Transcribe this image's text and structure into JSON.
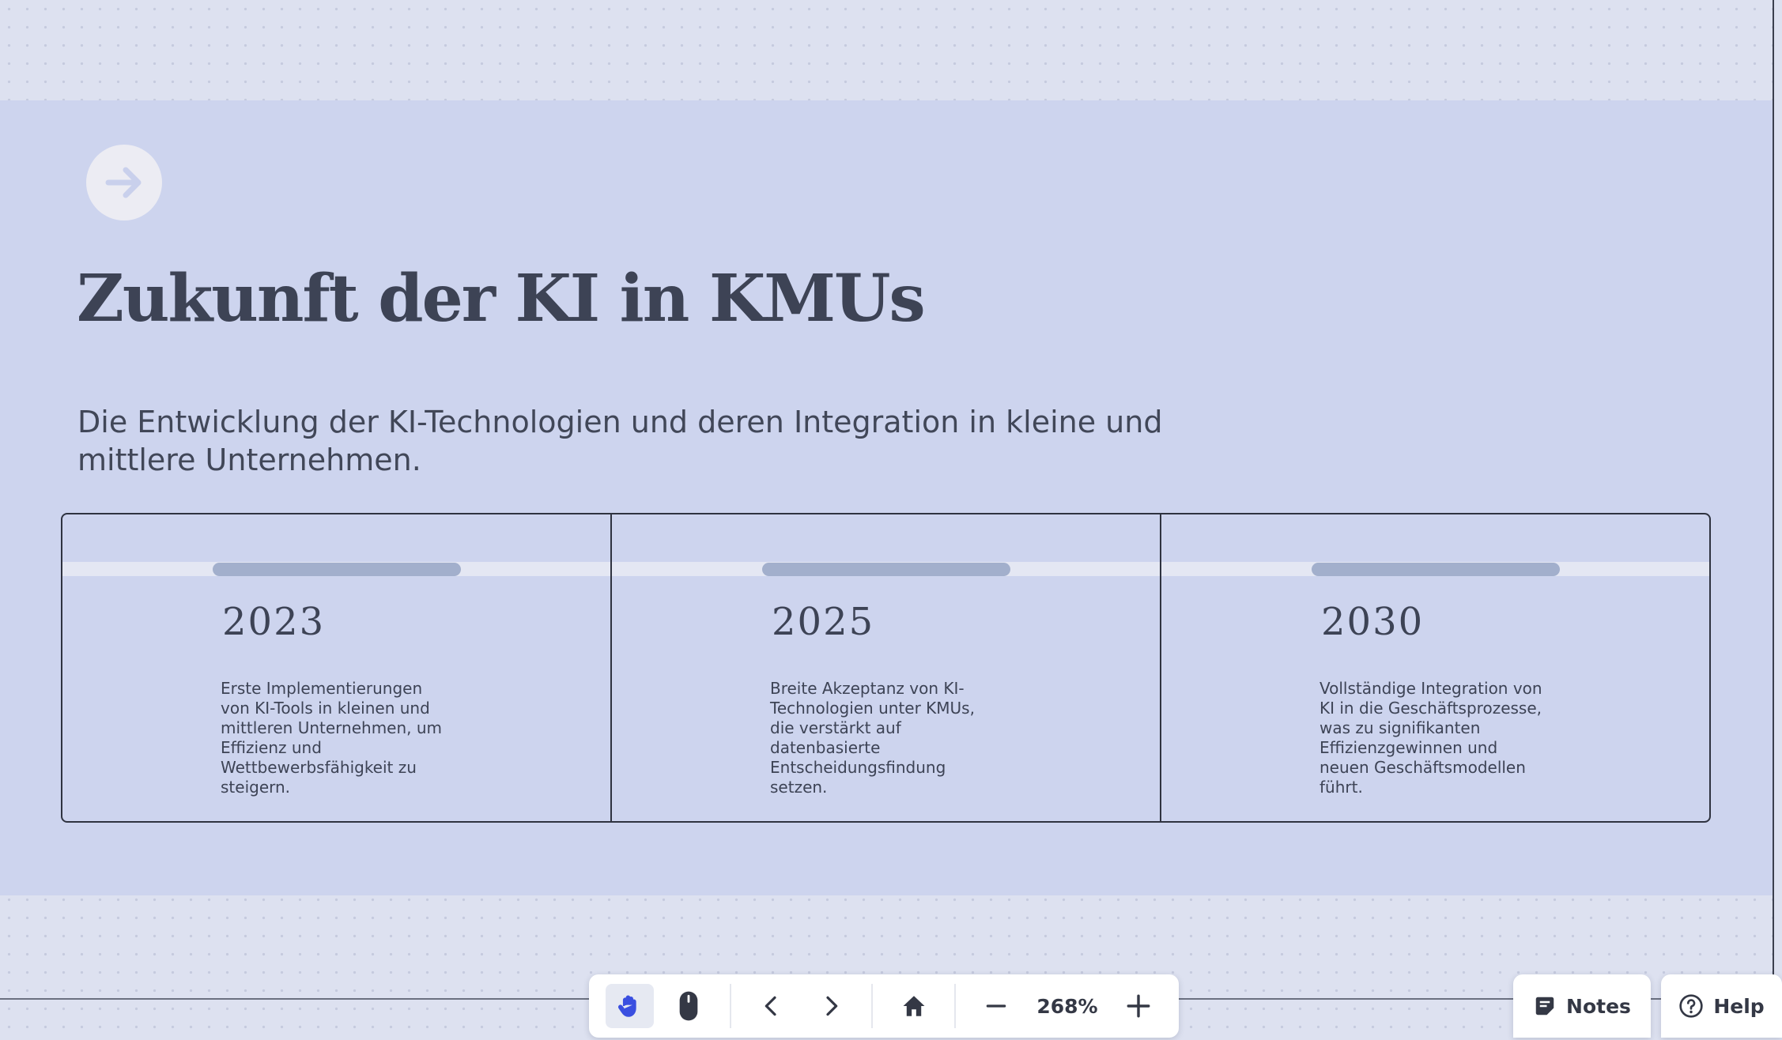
{
  "slide": {
    "title": "Zukunft der KI in KMUs",
    "subtitle": "Die Entwicklung der KI-Technologien und deren Integration in kleine und mittlere Unternehmen.",
    "next_icon": "arrow-right-icon",
    "timeline": [
      {
        "year": "2023",
        "description": "Erste Implementierungen von KI-Tools in kleinen und mittleren Unternehmen, um Effizienz und Wettbewerbsfähigkeit zu steigern."
      },
      {
        "year": "2025",
        "description": "Breite Akzeptanz von KI-Technologien unter KMUs, die verstärkt auf datenbasierte Entscheidungsfindung setzen."
      },
      {
        "year": "2030",
        "description": "Vollständige Integration von KI in die Geschäftsprozesse, was zu signifikanten Effizienzgewinnen und neuen Geschäftsmodellen führt."
      }
    ]
  },
  "toolbar": {
    "zoom": "268%",
    "tools": [
      "hand-icon",
      "mouse-icon",
      "chevron-left-icon",
      "chevron-right-icon",
      "home-icon",
      "minus-icon",
      "plus-icon"
    ],
    "active_tool": "hand-icon"
  },
  "notes_button": {
    "label": "Notes",
    "icon": "notes-icon"
  },
  "help_button": {
    "label": "Help",
    "icon": "help-icon"
  },
  "colors": {
    "canvas": "#dde1f0",
    "slide": "#cdd4ee",
    "text": "#3d4355",
    "accent": "#3a4fe0",
    "bar": "#a2afcc"
  }
}
